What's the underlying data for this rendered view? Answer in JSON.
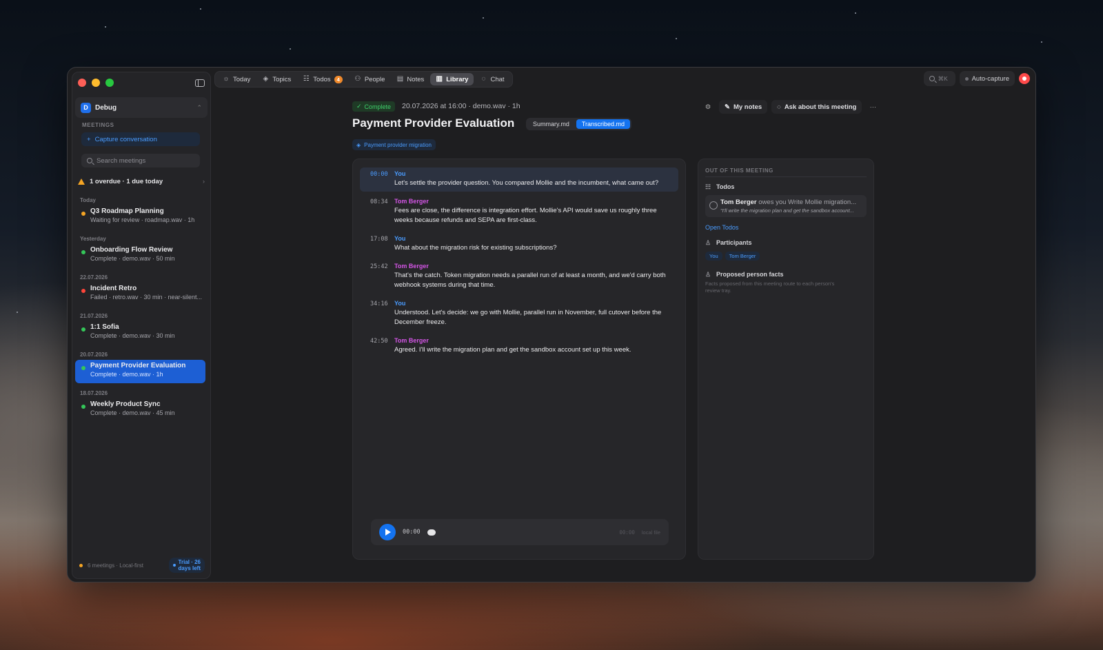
{
  "sidebar": {
    "workspace": {
      "badge": "D",
      "name": "Debug"
    },
    "section_label": "MEETINGS",
    "capture_label": "Capture conversation",
    "search_placeholder": "Search meetings",
    "overdue_text": "1 overdue · 1 due today",
    "groups": [
      {
        "label": "Today",
        "items": [
          {
            "title": "Q3 Roadmap Planning",
            "sub": "Waiting for review · roadmap.wav · 1h",
            "status": "orange"
          }
        ]
      },
      {
        "label": "Yesterday",
        "items": [
          {
            "title": "Onboarding Flow Review",
            "sub": "Complete · demo.wav · 50 min",
            "status": "green"
          }
        ]
      },
      {
        "label": "22.07.2026",
        "items": [
          {
            "title": "Incident Retro",
            "sub": "Failed · retro.wav · 30 min · near-silent...",
            "status": "red"
          }
        ]
      },
      {
        "label": "21.07.2026",
        "items": [
          {
            "title": "1:1 Sofia",
            "sub": "Complete · demo.wav · 30 min",
            "status": "green"
          }
        ]
      },
      {
        "label": "20.07.2026",
        "items": [
          {
            "title": "Payment Provider Evaluation",
            "sub": "Complete · demo.wav · 1h",
            "status": "green",
            "active": true
          }
        ]
      },
      {
        "label": "18.07.2026",
        "items": [
          {
            "title": "Weekly Product Sync",
            "sub": "Complete · demo.wav · 45 min",
            "status": "green"
          }
        ]
      }
    ],
    "footer": {
      "text": "6 meetings · Local-first",
      "trial_line1": "Trial · 26",
      "trial_line2": "days left"
    }
  },
  "nav": {
    "items": [
      {
        "label": "Today",
        "icon": "sun-icon"
      },
      {
        "label": "Topics",
        "icon": "layers-icon"
      },
      {
        "label": "Todos",
        "icon": "checklist-icon",
        "badge": "4"
      },
      {
        "label": "People",
        "icon": "people-icon"
      },
      {
        "label": "Notes",
        "icon": "note-icon"
      },
      {
        "label": "Library",
        "icon": "library-icon",
        "active": true
      },
      {
        "label": "Chat",
        "icon": "chat-icon"
      }
    ]
  },
  "topright": {
    "search_shortcut": "⌘K",
    "auto_capture": "Auto-capture"
  },
  "meeting": {
    "status": "Complete",
    "meta": "20.07.2026 at 16:00 · demo.wav · 1h",
    "title": "Payment Provider Evaluation",
    "files": [
      "Summary.md",
      "Transcribed.md"
    ],
    "active_file": "Transcribed.md",
    "topic": "Payment provider migration",
    "actions": {
      "my_notes": "My notes",
      "ask": "Ask about this meeting",
      "more": "···"
    }
  },
  "transcript": [
    {
      "time": "00:00",
      "speaker": "You",
      "text": "Let's settle the provider question. You compared Mollie and the incumbent, what came out?"
    },
    {
      "time": "08:34",
      "speaker": "Tom Berger",
      "text": "Fees are close, the difference is integration effort. Mollie's API would save us roughly three weeks because refunds and SEPA are first-class."
    },
    {
      "time": "17:08",
      "speaker": "You",
      "text": "What about the migration risk for existing subscriptions?"
    },
    {
      "time": "25:42",
      "speaker": "Tom Berger",
      "text": "That's the catch. Token migration needs a parallel run of at least a month, and we'd carry both webhook systems during that time."
    },
    {
      "time": "34:16",
      "speaker": "You",
      "text": "Understood. Let's decide: we go with Mollie, parallel run in November, full cutover before the December freeze."
    },
    {
      "time": "42:50",
      "speaker": "Tom Berger",
      "text": "Agreed. I'll write the migration plan and get the sandbox account set up this week."
    }
  ],
  "player": {
    "current": "00:00",
    "end": "00:00",
    "source": "local file"
  },
  "side_panel": {
    "header": "OUT OF THIS MEETING",
    "todos_label": "Todos",
    "todo": {
      "person": "Tom Berger",
      "rest": " owes you Write Mollie migration...",
      "quote": "\"I'll write the migration plan and get the sandbox account..."
    },
    "open_todos": "Open Todos",
    "participants_label": "Participants",
    "participants": [
      "You",
      "Tom Berger"
    ],
    "facts_label": "Proposed person facts",
    "facts_desc": "Facts proposed from this meeting route to each person's review tray."
  }
}
